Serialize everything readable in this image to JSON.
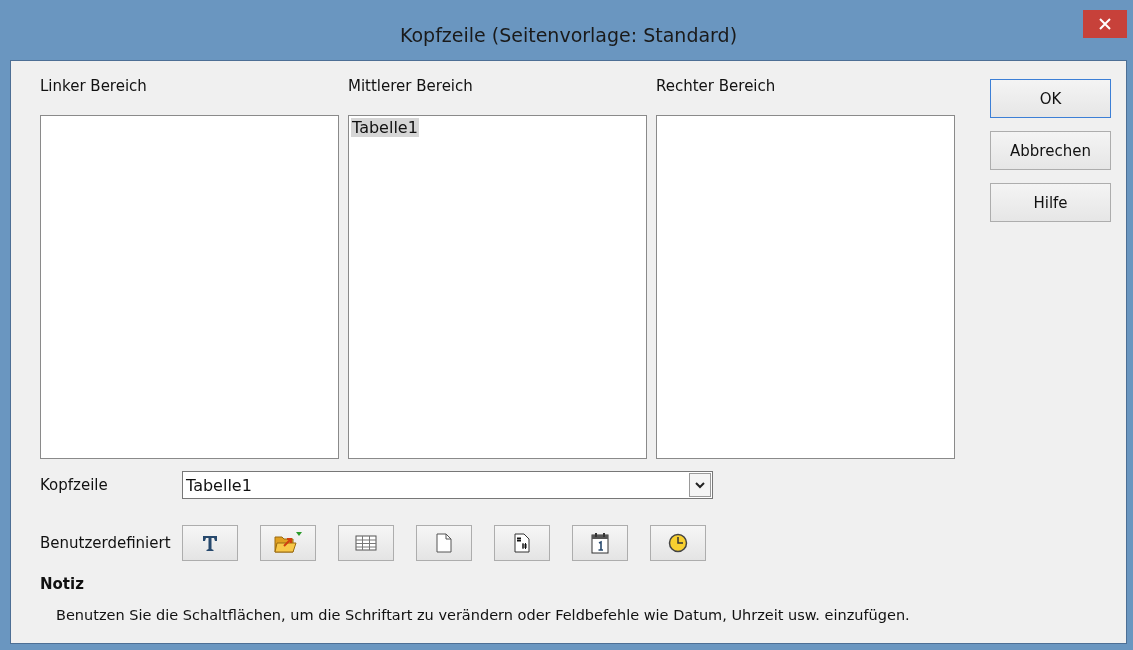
{
  "window": {
    "title": "Kopfzeile (Seitenvorlage: Standard)"
  },
  "areas": [
    {
      "label": "Linker Bereich"
    },
    {
      "label": "Mittlerer Bereich",
      "content": "Tabelle1"
    },
    {
      "label": "Rechter Bereich"
    }
  ],
  "header_select": {
    "label": "Kopfzeile",
    "value": "Tabelle1"
  },
  "custom": {
    "label": "Benutzerdefiniert",
    "tools": [
      {
        "kind": "text"
      },
      {
        "kind": "folder"
      },
      {
        "kind": "table"
      },
      {
        "kind": "page"
      },
      {
        "kind": "pages"
      },
      {
        "kind": "date"
      },
      {
        "kind": "time"
      }
    ]
  },
  "note": {
    "title": "Notiz",
    "text": "Benutzen Sie die Schaltflächen, um die Schriftart zu verändern oder Feldbefehle wie Datum, Uhrzeit usw. einzufügen."
  },
  "buttons": [
    {
      "label": "OK",
      "default": true
    },
    {
      "label": "Abbrechen",
      "default": false
    },
    {
      "label": "Hilfe",
      "default": false
    }
  ]
}
